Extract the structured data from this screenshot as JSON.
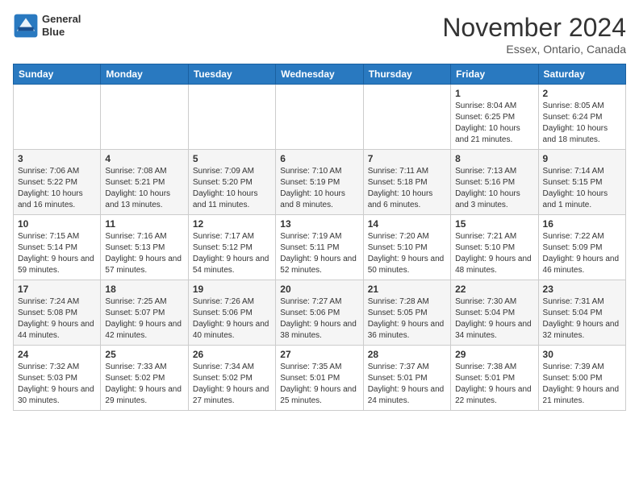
{
  "header": {
    "logo_line1": "General",
    "logo_line2": "Blue",
    "month": "November 2024",
    "location": "Essex, Ontario, Canada"
  },
  "weekdays": [
    "Sunday",
    "Monday",
    "Tuesday",
    "Wednesday",
    "Thursday",
    "Friday",
    "Saturday"
  ],
  "weeks": [
    [
      {
        "day": "",
        "info": ""
      },
      {
        "day": "",
        "info": ""
      },
      {
        "day": "",
        "info": ""
      },
      {
        "day": "",
        "info": ""
      },
      {
        "day": "",
        "info": ""
      },
      {
        "day": "1",
        "info": "Sunrise: 8:04 AM\nSunset: 6:25 PM\nDaylight: 10 hours and 21 minutes."
      },
      {
        "day": "2",
        "info": "Sunrise: 8:05 AM\nSunset: 6:24 PM\nDaylight: 10 hours and 18 minutes."
      }
    ],
    [
      {
        "day": "3",
        "info": "Sunrise: 7:06 AM\nSunset: 5:22 PM\nDaylight: 10 hours and 16 minutes."
      },
      {
        "day": "4",
        "info": "Sunrise: 7:08 AM\nSunset: 5:21 PM\nDaylight: 10 hours and 13 minutes."
      },
      {
        "day": "5",
        "info": "Sunrise: 7:09 AM\nSunset: 5:20 PM\nDaylight: 10 hours and 11 minutes."
      },
      {
        "day": "6",
        "info": "Sunrise: 7:10 AM\nSunset: 5:19 PM\nDaylight: 10 hours and 8 minutes."
      },
      {
        "day": "7",
        "info": "Sunrise: 7:11 AM\nSunset: 5:18 PM\nDaylight: 10 hours and 6 minutes."
      },
      {
        "day": "8",
        "info": "Sunrise: 7:13 AM\nSunset: 5:16 PM\nDaylight: 10 hours and 3 minutes."
      },
      {
        "day": "9",
        "info": "Sunrise: 7:14 AM\nSunset: 5:15 PM\nDaylight: 10 hours and 1 minute."
      }
    ],
    [
      {
        "day": "10",
        "info": "Sunrise: 7:15 AM\nSunset: 5:14 PM\nDaylight: 9 hours and 59 minutes."
      },
      {
        "day": "11",
        "info": "Sunrise: 7:16 AM\nSunset: 5:13 PM\nDaylight: 9 hours and 57 minutes."
      },
      {
        "day": "12",
        "info": "Sunrise: 7:17 AM\nSunset: 5:12 PM\nDaylight: 9 hours and 54 minutes."
      },
      {
        "day": "13",
        "info": "Sunrise: 7:19 AM\nSunset: 5:11 PM\nDaylight: 9 hours and 52 minutes."
      },
      {
        "day": "14",
        "info": "Sunrise: 7:20 AM\nSunset: 5:10 PM\nDaylight: 9 hours and 50 minutes."
      },
      {
        "day": "15",
        "info": "Sunrise: 7:21 AM\nSunset: 5:10 PM\nDaylight: 9 hours and 48 minutes."
      },
      {
        "day": "16",
        "info": "Sunrise: 7:22 AM\nSunset: 5:09 PM\nDaylight: 9 hours and 46 minutes."
      }
    ],
    [
      {
        "day": "17",
        "info": "Sunrise: 7:24 AM\nSunset: 5:08 PM\nDaylight: 9 hours and 44 minutes."
      },
      {
        "day": "18",
        "info": "Sunrise: 7:25 AM\nSunset: 5:07 PM\nDaylight: 9 hours and 42 minutes."
      },
      {
        "day": "19",
        "info": "Sunrise: 7:26 AM\nSunset: 5:06 PM\nDaylight: 9 hours and 40 minutes."
      },
      {
        "day": "20",
        "info": "Sunrise: 7:27 AM\nSunset: 5:06 PM\nDaylight: 9 hours and 38 minutes."
      },
      {
        "day": "21",
        "info": "Sunrise: 7:28 AM\nSunset: 5:05 PM\nDaylight: 9 hours and 36 minutes."
      },
      {
        "day": "22",
        "info": "Sunrise: 7:30 AM\nSunset: 5:04 PM\nDaylight: 9 hours and 34 minutes."
      },
      {
        "day": "23",
        "info": "Sunrise: 7:31 AM\nSunset: 5:04 PM\nDaylight: 9 hours and 32 minutes."
      }
    ],
    [
      {
        "day": "24",
        "info": "Sunrise: 7:32 AM\nSunset: 5:03 PM\nDaylight: 9 hours and 30 minutes."
      },
      {
        "day": "25",
        "info": "Sunrise: 7:33 AM\nSunset: 5:02 PM\nDaylight: 9 hours and 29 minutes."
      },
      {
        "day": "26",
        "info": "Sunrise: 7:34 AM\nSunset: 5:02 PM\nDaylight: 9 hours and 27 minutes."
      },
      {
        "day": "27",
        "info": "Sunrise: 7:35 AM\nSunset: 5:01 PM\nDaylight: 9 hours and 25 minutes."
      },
      {
        "day": "28",
        "info": "Sunrise: 7:37 AM\nSunset: 5:01 PM\nDaylight: 9 hours and 24 minutes."
      },
      {
        "day": "29",
        "info": "Sunrise: 7:38 AM\nSunset: 5:01 PM\nDaylight: 9 hours and 22 minutes."
      },
      {
        "day": "30",
        "info": "Sunrise: 7:39 AM\nSunset: 5:00 PM\nDaylight: 9 hours and 21 minutes."
      }
    ]
  ]
}
